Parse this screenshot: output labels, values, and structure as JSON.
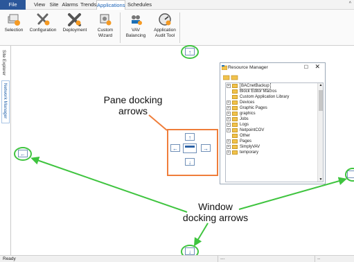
{
  "menubar": {
    "items": [
      "File",
      "View",
      "Site",
      "Alarms",
      "Trends",
      "Applications",
      "Schedules"
    ],
    "active": "Applications",
    "collapse_glyph": "^"
  },
  "ribbon": {
    "buttons": [
      {
        "label": "Selection",
        "icon": "selection-icon"
      },
      {
        "label": "Configuration",
        "icon": "configuration-icon"
      },
      {
        "label": "Deployment",
        "icon": "deployment-icon"
      },
      {
        "label": "Custom\nWizard",
        "icon": "custom-wizard-icon"
      },
      {
        "label": "VAV\nBalancing",
        "icon": "vav-balancing-icon"
      },
      {
        "label": "Application\nAudit Tool",
        "icon": "audit-tool-icon"
      }
    ]
  },
  "left_tabs": [
    "Site Explorer",
    "Network Manager"
  ],
  "resource_manager": {
    "title": "Resource Manager",
    "minmax_glyph": "☐",
    "close_glyph": "✕",
    "items": [
      {
        "label": "BACnetBackup",
        "selected": true
      },
      {
        "label": "Block Editor Macros",
        "expander": false
      },
      {
        "label": "Custom Application Library",
        "expander": false
      },
      {
        "label": "Devices",
        "expander": true
      },
      {
        "label": "Graphic Pages",
        "expander": true
      },
      {
        "label": "graphics",
        "expander": true
      },
      {
        "label": "Jobs",
        "expander": true
      },
      {
        "label": "Logs",
        "expander": true
      },
      {
        "label": "NetpointCOV",
        "expander": true
      },
      {
        "label": "Other",
        "expander": false
      },
      {
        "label": "Pages",
        "expander": true
      },
      {
        "label": "SimplyVAV",
        "expander": true
      },
      {
        "label": "temporary",
        "expander": true
      }
    ]
  },
  "annotations": {
    "pane_docking": "Pane docking\narrows",
    "window_docking": "Window\ndocking arrows"
  },
  "statusbar": {
    "status": "Ready",
    "field1": "---",
    "field2": "--"
  },
  "colors": {
    "file_tab": "#2b579a",
    "active_tab_text": "#1a63b8",
    "highlight_green": "#3fc43f",
    "pane_box": "#ef7d3a",
    "dock_arrow": "#2c62a6"
  }
}
